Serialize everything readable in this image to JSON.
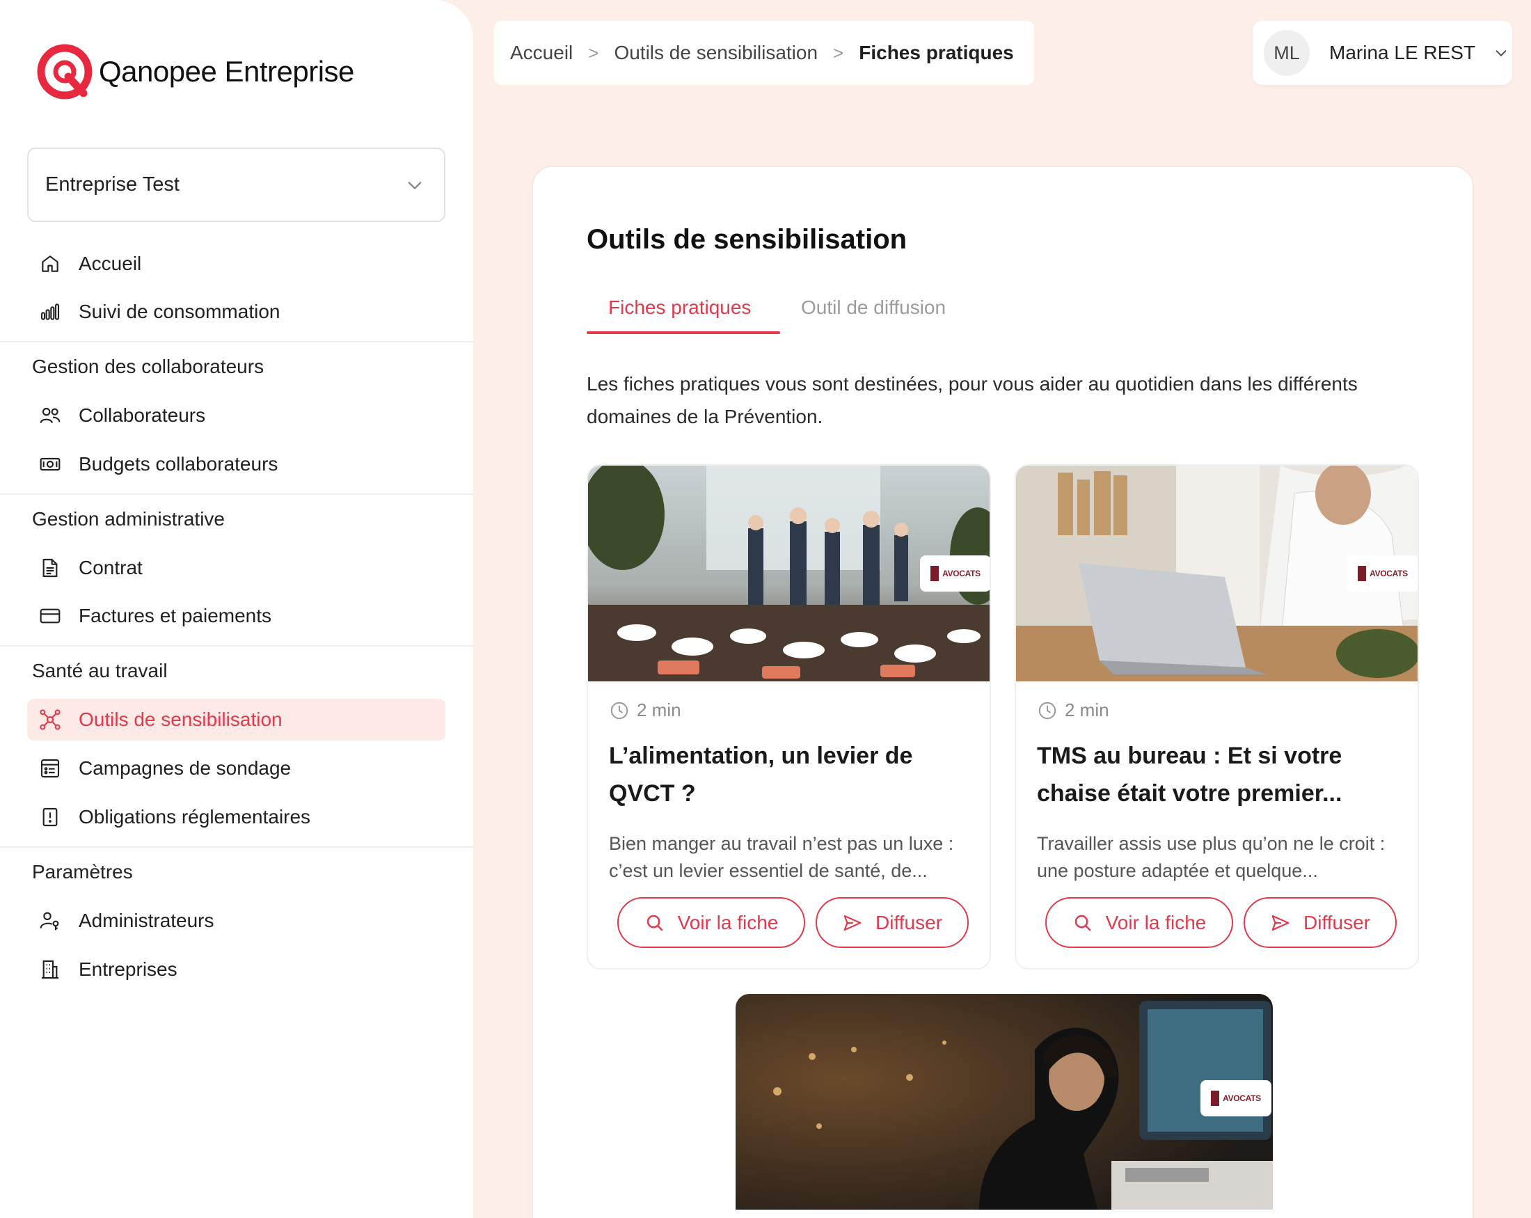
{
  "brand": {
    "name": "Qanopee Entreprise",
    "accent_color": "#e03a4c"
  },
  "company_selector": {
    "value": "Entreprise Test"
  },
  "sidebar": {
    "top_items": [
      {
        "label": "Accueil",
        "icon": "home-icon"
      },
      {
        "label": "Suivi de consommation",
        "icon": "bar-chart-icon"
      }
    ],
    "sections": [
      {
        "title": "Gestion des collaborateurs",
        "items": [
          {
            "label": "Collaborateurs",
            "icon": "users-icon"
          },
          {
            "label": "Budgets collaborateurs",
            "icon": "money-icon"
          }
        ]
      },
      {
        "title": "Gestion administrative",
        "items": [
          {
            "label": "Contrat",
            "icon": "document-icon"
          },
          {
            "label": "Factures et paiements",
            "icon": "credit-card-icon"
          }
        ]
      },
      {
        "title": "Santé au travail",
        "items": [
          {
            "label": "Outils de sensibilisation",
            "icon": "network-icon",
            "active": true
          },
          {
            "label": "Campagnes de sondage",
            "icon": "survey-icon"
          },
          {
            "label": "Obligations réglementaires",
            "icon": "alert-document-icon"
          }
        ]
      },
      {
        "title": "Paramètres",
        "items": [
          {
            "label": "Administrateurs",
            "icon": "admin-user-icon"
          },
          {
            "label": "Entreprises",
            "icon": "building-icon"
          }
        ]
      }
    ]
  },
  "breadcrumb": {
    "items": [
      "Accueil",
      "Outils de sensibilisation",
      "Fiches pratiques"
    ],
    "separator": ">"
  },
  "user": {
    "initials": "ML",
    "name": "Marina LE REST"
  },
  "main": {
    "title": "Outils de sensibilisation",
    "tabs": [
      {
        "label": "Fiches pratiques",
        "active": true
      },
      {
        "label": "Outil de diffusion",
        "active": false
      }
    ],
    "intro": "Les fiches pratiques vous sont destinées, pour vous aider au quotidien dans les différents domaines de la Prévention.",
    "articles": [
      {
        "read_time": "2 min",
        "title": "L’alimentation, un levier de QVCT ?",
        "excerpt": "Bien manger au travail n’est pas un luxe : c’est un levier essentiel de santé, de...",
        "view_label": "Voir la fiche",
        "share_label": "Diffuser",
        "image": "office-buffet-photo"
      },
      {
        "read_time": "2 min",
        "title": "TMS au bureau : Et si votre chaise était votre premier...",
        "excerpt": "Travailler assis use plus qu’on ne le croit : une posture adaptée et quelque...",
        "view_label": "Voir la fiche",
        "share_label": "Diffuser",
        "image": "laptop-worker-photo"
      },
      {
        "image": "stressed-woman-computer-photo"
      }
    ],
    "partner_badge": "AVOCATS"
  }
}
